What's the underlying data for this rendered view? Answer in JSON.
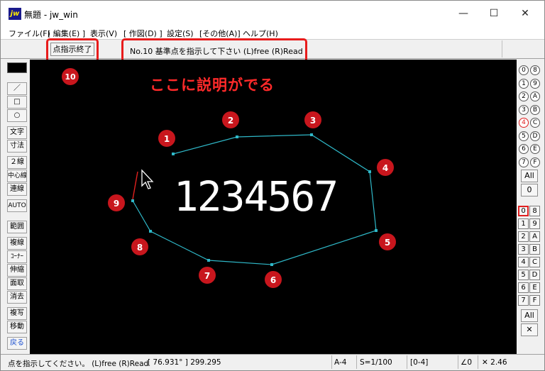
{
  "window": {
    "app_icon": "jw",
    "title": "無題 - jw_win",
    "minimize": "—",
    "maximize": "☐",
    "close": "✕"
  },
  "menu": [
    "ファイル(F)",
    "[ 編集(E) ]",
    "表示(V)",
    "[ 作図(D) ]",
    "設定(S)",
    "[その他(A)]",
    "ヘルプ(H)"
  ],
  "control_bar": {
    "end_button": "点指示終了",
    "message": "No.10  基準点を指示して下さい  (L)free  (R)Read"
  },
  "callout": "ここに説明がでる",
  "markers": [
    "1",
    "2",
    "3",
    "4",
    "5",
    "6",
    "7",
    "8",
    "9",
    "10"
  ],
  "canvas_text": "1234567",
  "colors": {
    "accent_red": "#e81c1c",
    "marker_red": "#c8161d",
    "polyline": "#2fb8c8",
    "canvas_bg": "#000000"
  },
  "left_tools": {
    "line": "／",
    "rect": "□",
    "circle": "○",
    "text": "文字",
    "dimension": "寸法",
    "double_line": "２線",
    "center_line": "中心線",
    "continuous": "連線",
    "auto": "AUTO",
    "range": "範囲",
    "copy_line": "複線",
    "corner": "ｺｰﾅｰ",
    "stretch": "伸縮",
    "chamfer": "面取",
    "erase": "消去",
    "copy": "複写",
    "move": "移動",
    "back": "戻る"
  },
  "right_layers": {
    "group_circles": [
      [
        "0",
        "8"
      ],
      [
        "1",
        "9"
      ],
      [
        "2",
        "A"
      ],
      [
        "3",
        "B"
      ],
      [
        "4",
        "C"
      ],
      [
        "5",
        "D"
      ],
      [
        "6",
        "E"
      ],
      [
        "7",
        "F"
      ]
    ],
    "group_all": "All",
    "group_current": "0",
    "layer_squares": [
      [
        "0",
        "8"
      ],
      [
        "1",
        "9"
      ],
      [
        "2",
        "A"
      ],
      [
        "3",
        "B"
      ],
      [
        "4",
        "C"
      ],
      [
        "5",
        "D"
      ],
      [
        "6",
        "E"
      ],
      [
        "7",
        "F"
      ]
    ],
    "layer_all": "All",
    "cross_icon": "✕"
  },
  "status": {
    "hint": "点を指示してください。 (L)free (R)Read",
    "angle_coord": "[ 76.931° ]  299.295",
    "paper": "A-4",
    "scale": "S=1/100",
    "layer": "[0-4]",
    "angle": "∠0",
    "factor": "✕ 2.46"
  }
}
